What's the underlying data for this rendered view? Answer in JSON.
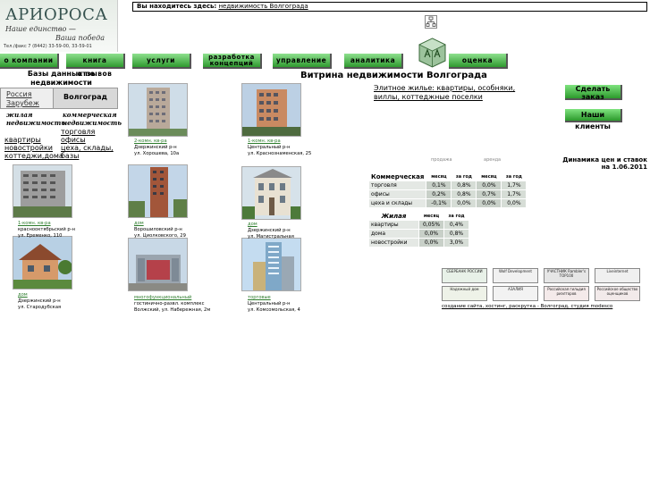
{
  "logo": {
    "name": "АРИОРОСА",
    "slogan_line1": "Наше единство —",
    "slogan_line2": "Ваша победа",
    "phone": "Тел./факс 7 (8442) 33-59-00, 33-59-01"
  },
  "breadcrumb": {
    "prefix": "Вы находитесь здесь:",
    "current": "недвижимость Волгограда"
  },
  "nav": [
    {
      "label": "о компании"
    },
    {
      "label": "книга отзывов"
    },
    {
      "label": "услуги"
    },
    {
      "label": "разработка концепций"
    },
    {
      "label": "управление"
    },
    {
      "label": "аналитика"
    },
    {
      "label": "оценка"
    }
  ],
  "left": {
    "header": "Базы данных по недвижимости",
    "regions": [
      "Россия",
      "Зарубеж"
    ],
    "selected_region": "Волгоград",
    "residential": {
      "title": "жилая недвижимость",
      "links": [
        "квартиры",
        "новостройки",
        "коттеджи,дома"
      ]
    },
    "commercial": {
      "title": "коммерческая недвижимость",
      "links": [
        "торговля",
        "офисы",
        "цеха, склады, базы"
      ]
    }
  },
  "page_title": "Витрина недвижимости Волгограда",
  "listings": [
    {
      "type": "2-комн. кв-ра",
      "district": "Дзержинский р-н",
      "address": "ул. Хорошева, 10а"
    },
    {
      "type": "1-комн. кв-ра",
      "district": "Центральный р-н",
      "address": "ул. Краснознаменская, 25"
    },
    {
      "type": "1-комн. кв-ра",
      "district": "краснооктябрьский р-н",
      "address": "ул. Еременко, 110"
    },
    {
      "type": "дом",
      "district": "Ворошиловский р-н",
      "address": "ул. Циолковского, 29"
    },
    {
      "type": "дом",
      "district": "Дзержинский р-н",
      "address": "ул. Магистральная"
    },
    {
      "type": "дом",
      "district": "Дзержинский р-н",
      "address": "ул. Стародубская"
    },
    {
      "type": "многофункциональный",
      "district": "гостинично-развл. комплекс",
      "address": "Волжский, ул. Набережная, 2м"
    },
    {
      "type": "торговые",
      "district": "Центральный р-н",
      "address": "ул. Комсомольская, 4"
    }
  ],
  "elite": {
    "line1": "Элитное жилье: квартиры, особняки,",
    "line2": "виллы, коттеджные поселки"
  },
  "buttons": {
    "order": "Сделать заказ",
    "clients": "Наши клиенты"
  },
  "dynamics": {
    "title": "Динамика цен и ставок",
    "date": "на 1.06.2011",
    "col_groups": [
      "продажа",
      "аренда"
    ],
    "cols": [
      "месяц",
      "за год",
      "месяц",
      "за год"
    ],
    "commercial": {
      "title": "Коммерческая",
      "rows": [
        {
          "label": "торговля",
          "values": [
            "0,1%",
            "0,8%",
            "0,0%",
            "1,7%"
          ]
        },
        {
          "label": "офисы",
          "values": [
            "0,2%",
            "0,8%",
            "0,7%",
            "1,7%"
          ]
        },
        {
          "label": "цеха и склады",
          "values": [
            "-0,1%",
            "0,0%",
            "0,0%",
            "0,0%"
          ]
        }
      ]
    },
    "residential": {
      "title": "Жилая",
      "cols": [
        "месяц",
        "за год"
      ],
      "rows": [
        {
          "label": "квартиры",
          "values": [
            "0,05%",
            "0,4%"
          ]
        },
        {
          "label": "дома",
          "values": [
            "0,0%",
            "0,8%"
          ]
        },
        {
          "label": "новостройки",
          "values": [
            "0,0%",
            "3,0%"
          ]
        }
      ]
    }
  },
  "partners": [
    {
      "label": "СБЕРБАНК РОССИИ"
    },
    {
      "label": "Wolf Development"
    },
    {
      "label": "УЧАСТНИК Rambler's TOP100"
    },
    {
      "label": "Liveinternet"
    },
    {
      "label": "Надежный дом"
    },
    {
      "label": "АЗАЛИЯ"
    },
    {
      "label": "Российская гильдия риэлторов"
    },
    {
      "label": "Российское общество оценщиков"
    }
  ],
  "footer": "создание сайта, хостинг, раскрутка - Волгоград, студия modesco"
}
